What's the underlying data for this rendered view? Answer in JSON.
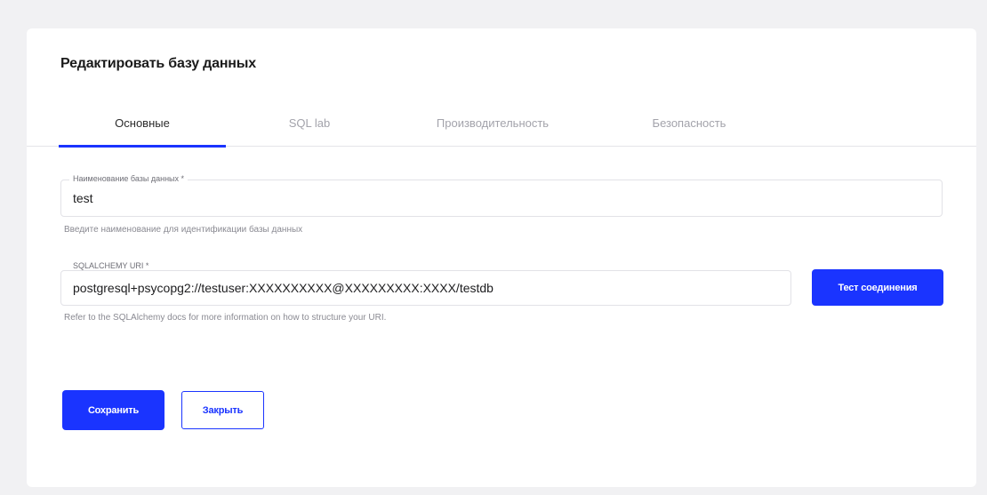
{
  "dialog": {
    "title": "Редактировать базу данных"
  },
  "tabs": [
    {
      "label": "Основные",
      "active": true
    },
    {
      "label": "SQL lab",
      "active": false
    },
    {
      "label": "Производительность",
      "active": false
    },
    {
      "label": "Безопасность",
      "active": false
    }
  ],
  "form": {
    "db_name": {
      "label": "Наименование базы данных *",
      "value": "test",
      "hint": "Введите наименование для идентификации базы данных"
    },
    "uri": {
      "label": "SQLALCHEMY URI *",
      "value": "postgresql+psycopg2://testuser:XXXXXXXXXX@XXXXXXXXX:XXXX/testdb",
      "hint": "Refer to the SQLAlchemy docs for more information on how to structure your URI."
    },
    "test_button": "Тест соединения"
  },
  "actions": {
    "save": "Сохранить",
    "close": "Закрыть"
  },
  "colors": {
    "accent": "#1a34ff",
    "background": "#f1f1f3",
    "card": "#ffffff"
  }
}
